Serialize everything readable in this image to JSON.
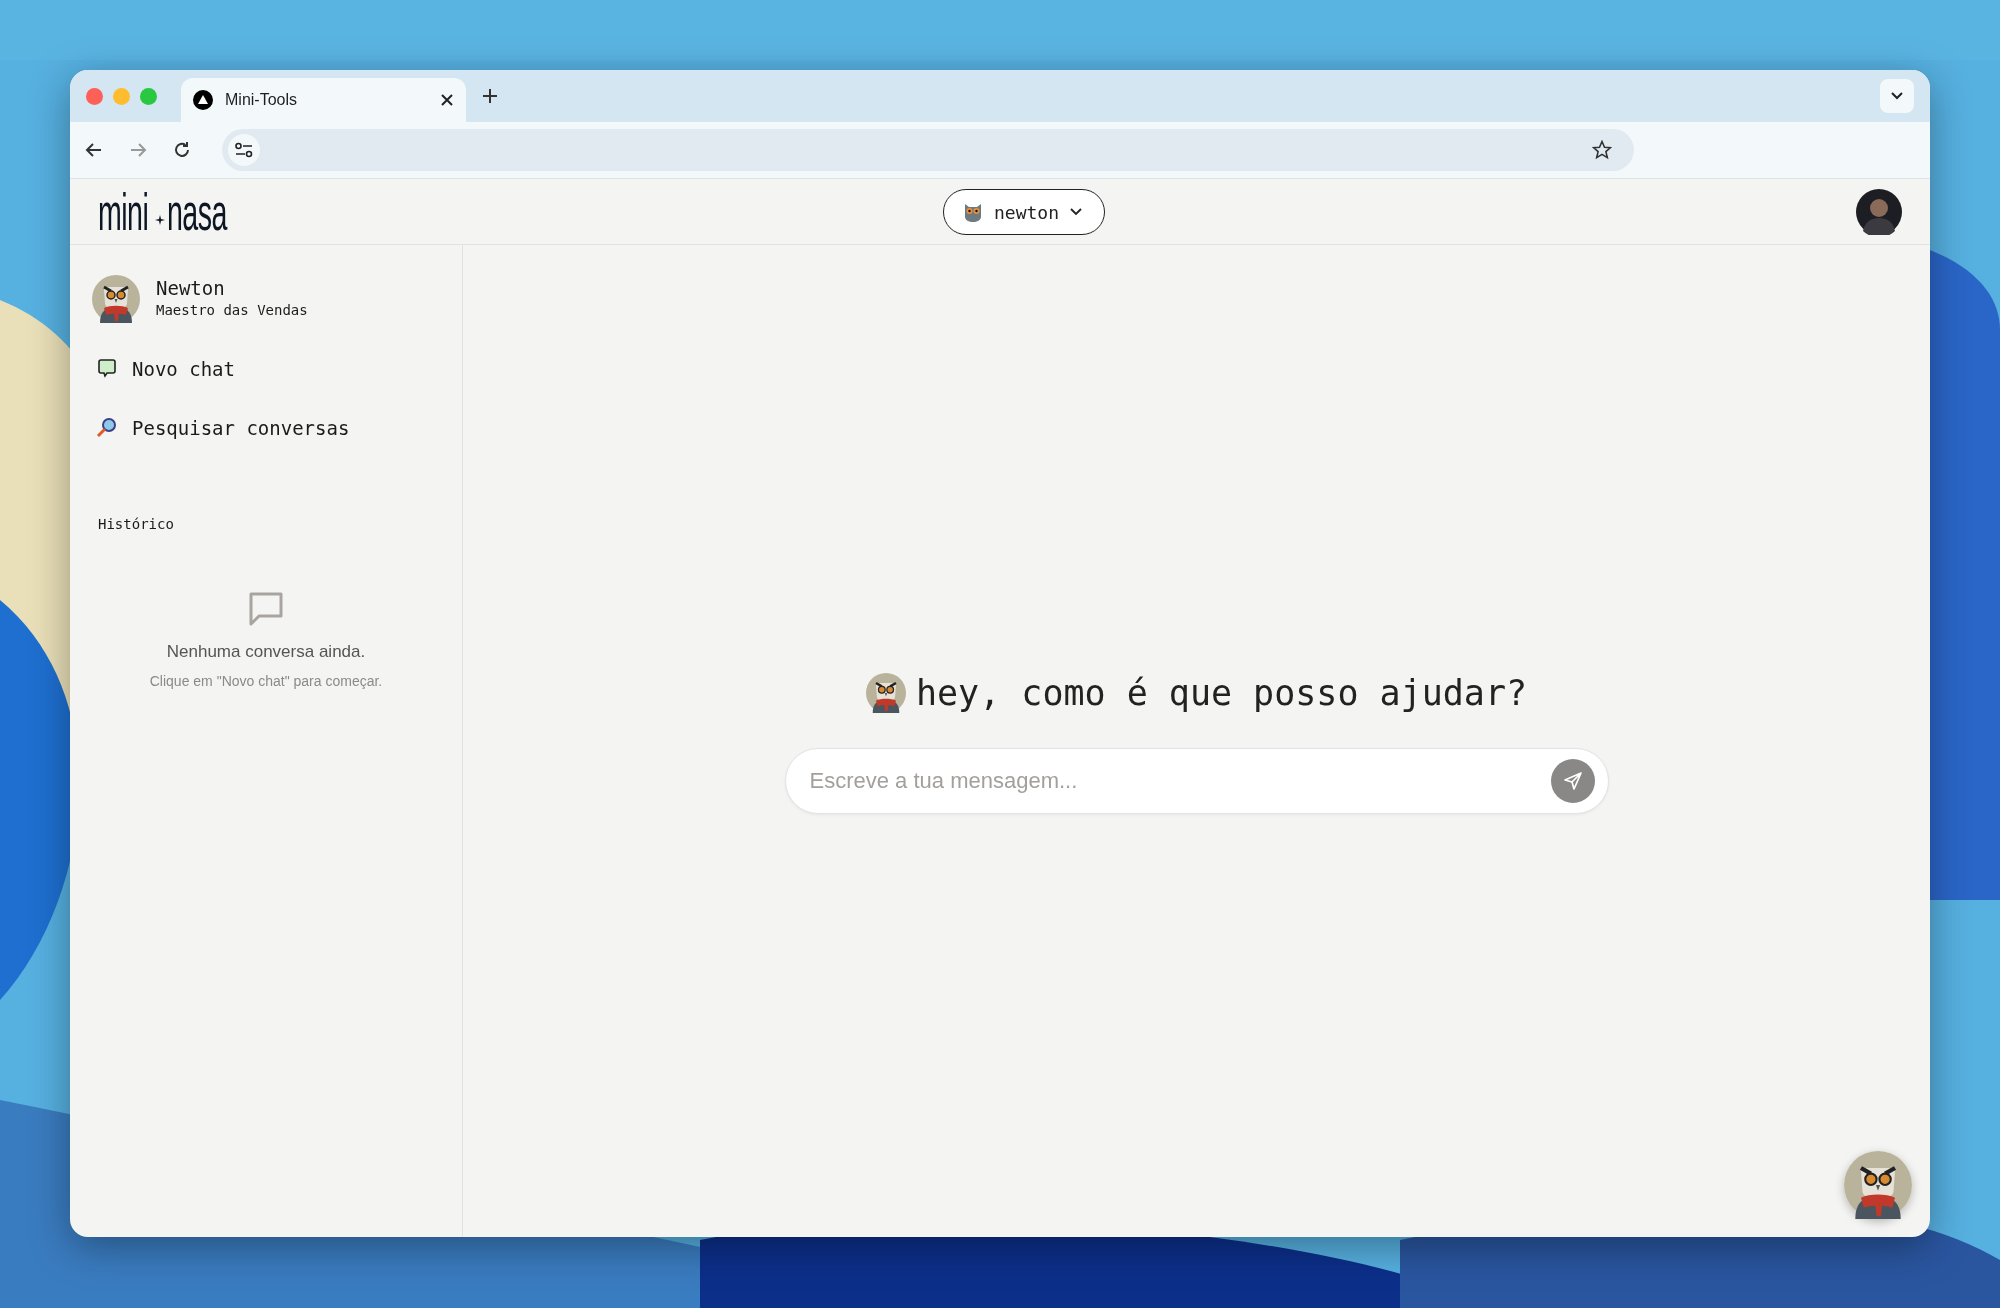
{
  "browser": {
    "tab": {
      "title": "Mini-Tools"
    }
  },
  "header": {
    "logo": {
      "left": "mini",
      "right": "nasa"
    },
    "agent_selector": {
      "label": "newton"
    }
  },
  "sidebar": {
    "profile": {
      "name": "Newton",
      "role": "Maestro das Vendas"
    },
    "items": [
      {
        "kind": "new",
        "label": "Novo chat"
      },
      {
        "kind": "search",
        "label": "Pesquisar conversas"
      }
    ],
    "history": {
      "title": "Histórico",
      "empty_title": "Nenhuma conversa ainda.",
      "empty_hint": "Clique em \"Novo chat\" para começar."
    }
  },
  "main": {
    "greeting": "hey, como é que posso ajudar?",
    "input": {
      "placeholder": "Escreve a tua mensagem..."
    }
  }
}
